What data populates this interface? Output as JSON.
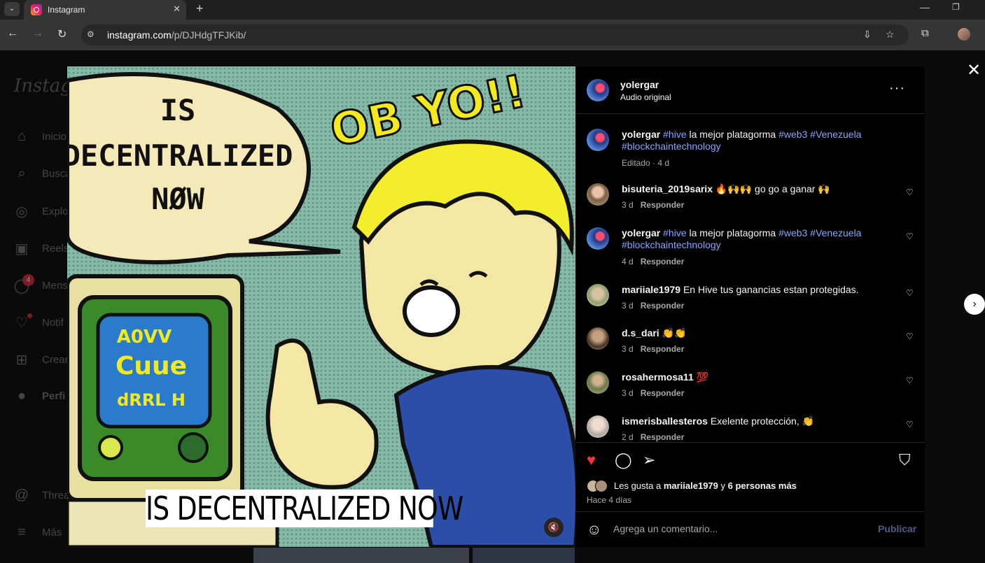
{
  "browser": {
    "tab_title": "Instagram",
    "url_host": "instagram.com",
    "url_path": "/p/DJHdgTFJKib/"
  },
  "sidebar": {
    "logo": "Instagram",
    "items": [
      {
        "label": "Inicio",
        "icon": "home-icon"
      },
      {
        "label": "Busca",
        "icon": "search-icon"
      },
      {
        "label": "Explo",
        "icon": "compass-icon"
      },
      {
        "label": "Reels",
        "icon": "reels-icon"
      },
      {
        "label": "Mens",
        "icon": "messenger-icon"
      },
      {
        "label": "Notif",
        "icon": "heart-icon"
      },
      {
        "label": "Crear",
        "icon": "plus-icon"
      },
      {
        "label": "Perfi",
        "icon": "avatar"
      },
      {
        "label": "Threa",
        "icon": "threads-icon"
      },
      {
        "label": "Más",
        "icon": "menu-icon"
      }
    ],
    "messages_badge": "4"
  },
  "post": {
    "image": {
      "bubble_text": [
        "IS",
        "DECENTRALIZED",
        "NØW"
      ],
      "shout_text": "OB YO!!",
      "caption_strip": "IS DECENTRALIZED NOW"
    },
    "author": "yolergar",
    "audio": "Audio original",
    "caption": {
      "user": "yolergar",
      "parts": [
        "#hive",
        " la mejor platagorma ",
        "#web3",
        " ",
        "#Venezuela",
        " ",
        "#blockchaintechnology"
      ],
      "meta": "Editado · 4 d"
    },
    "comments": [
      {
        "user": "bisuteria_2019sarix",
        "text": "🔥🙌🙌 go go a ganar 🙌",
        "time": "3 d",
        "reply": "Responder"
      },
      {
        "user": "yolergar",
        "text_parts": [
          "#hive",
          " la mejor platagorma ",
          "#web3",
          " ",
          "#Venezuela",
          " ",
          "#blockchaintechnology"
        ],
        "time": "4 d",
        "reply": "Responder"
      },
      {
        "user": "mariiale1979",
        "text": "En Hive tus ganancias estan protegidas.",
        "time": "3 d",
        "reply": "Responder"
      },
      {
        "user": "d.s_dari",
        "text": "👏👏",
        "time": "3 d",
        "reply": "Responder"
      },
      {
        "user": "rosahermosa11",
        "text": "💯",
        "time": "3 d",
        "reply": "Responder"
      },
      {
        "user": "ismerisballesteros",
        "text": "Exelente protección, 👏",
        "time": "2 d",
        "reply": "Responder"
      }
    ],
    "likes": {
      "prefix": "Les gusta a ",
      "user": "mariiale1979",
      "mid": " y ",
      "others": "6 personas más"
    },
    "time_ago": "Hace 4 días",
    "comment_placeholder": "Agrega un comentario...",
    "publish_label": "Publicar",
    "liked": true
  },
  "colors": {
    "like_red": "#ff3040",
    "hashtag_blue": "#8aa6ff",
    "muted_gray": "#a8a8a8"
  }
}
